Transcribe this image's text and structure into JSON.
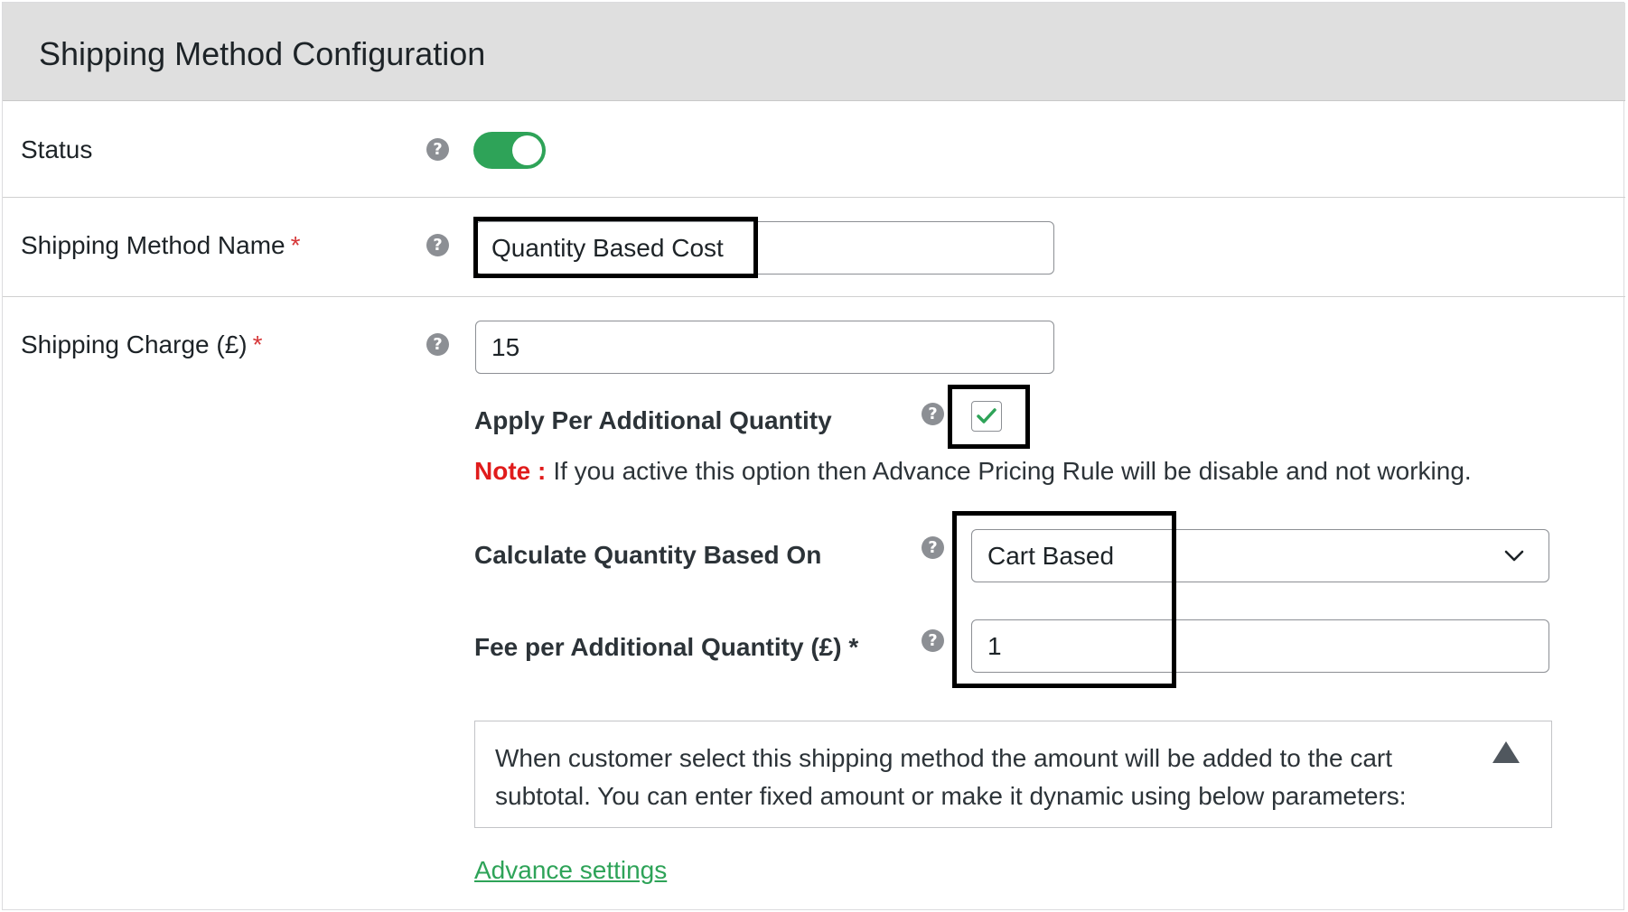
{
  "header": {
    "title": "Shipping Method Configuration"
  },
  "required_mark": "*",
  "help_glyph": "?",
  "status": {
    "label": "Status",
    "enabled": true
  },
  "method_name": {
    "label": "Shipping Method Name",
    "value": "Quantity Based Cost"
  },
  "shipping_charge": {
    "label": "Shipping Charge (£)",
    "value": "15"
  },
  "apply_per_qty": {
    "label": "Apply Per Additional Quantity",
    "checked": true
  },
  "note": {
    "label": "Note :",
    "text": "If you active this option then Advance Pricing Rule will be disable and not working."
  },
  "calc_based_on": {
    "label": "Calculate Quantity Based On",
    "selected": "Cart Based"
  },
  "fee_per_qty": {
    "label": "Fee per Additional Quantity (£)",
    "value": "1"
  },
  "info": {
    "text": "When customer select this shipping method the amount will be added to the cart subtotal. You can enter fixed amount or make it dynamic using below parameters:"
  },
  "advance_link": {
    "label": "Advance settings"
  },
  "colors": {
    "accent": "#2ea358",
    "required": "#d63638",
    "note": "#e01b1b",
    "highlight": "#000000"
  }
}
